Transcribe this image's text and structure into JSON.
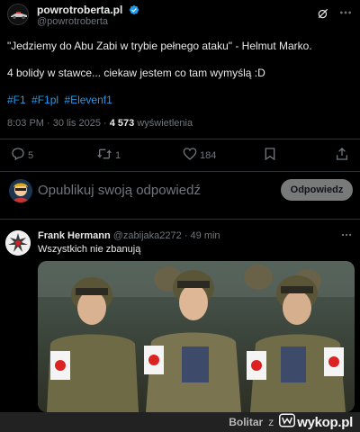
{
  "tweet": {
    "author_name": "powrotroberta.pl",
    "author_handle": "@powrotroberta",
    "line1": "\"Jedziemy do Abu Zabi w trybie pełnego ataku\" - Helmut Marko.",
    "line2": "4 bolidy w stawce... ciekaw jestem co tam wymyślą :D",
    "hashtags": [
      "#F1",
      "#F1pl",
      "#Elevenf1"
    ],
    "time": "8:03 PM · 30 lis 2025 · ",
    "views_count": "4 573",
    "views_label": " wyświetlenia",
    "actions": {
      "replies": "5",
      "reposts": "1",
      "likes": "184"
    }
  },
  "reply_box": {
    "placeholder": "Opublikuj swoją odpowiedź",
    "button_label": "Odpowiedz"
  },
  "reply": {
    "author_name": "Frank Hermann",
    "author_handle": "@zabijaka2272 · 49 min",
    "text": "Wszystkich nie zbanują"
  },
  "footer": {
    "username": "Bolitar",
    "connector": "z",
    "site": "wykop.pl"
  },
  "colors": {
    "background": "#000000",
    "link": "#1d9bf0",
    "muted": "#71767b",
    "verified": "#1d9bf0"
  }
}
